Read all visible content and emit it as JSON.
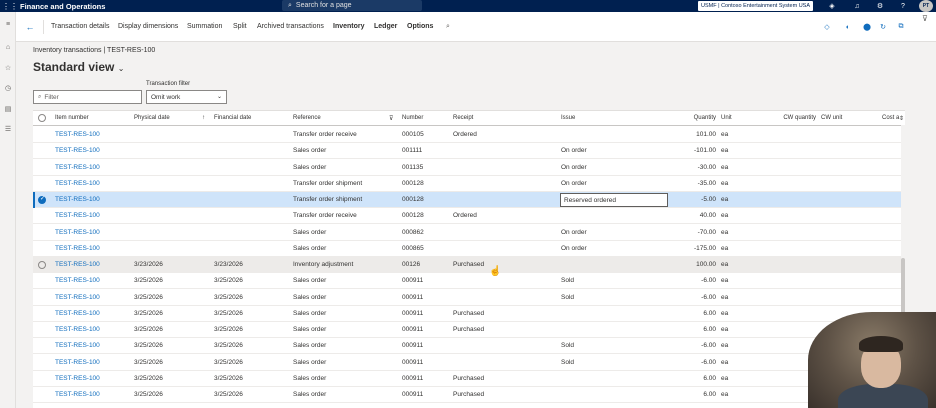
{
  "topbar": {
    "app_title": "Finance and Operations",
    "search_placeholder": "Search for a page",
    "company": "USMF | Contoso Entertainment System USA",
    "user_initials": "PT"
  },
  "actionpane": {
    "items": [
      {
        "label": "Transaction details",
        "bold": false
      },
      {
        "label": "Display dimensions",
        "bold": false
      },
      {
        "label": "Summation",
        "bold": false
      },
      {
        "label": "Split",
        "bold": false
      },
      {
        "label": "Archived transactions",
        "bold": false
      },
      {
        "label": "Inventory",
        "bold": true
      },
      {
        "label": "Ledger",
        "bold": true
      },
      {
        "label": "Options",
        "bold": true
      }
    ]
  },
  "breadcrumb": "Inventory transactions  |  TEST-RES-100",
  "page_title": "Standard view",
  "filter": {
    "placeholder": "Filter"
  },
  "transaction_filter": {
    "label": "Transaction filter",
    "value": "Omit work"
  },
  "grid": {
    "columns": {
      "item_number": "Item number",
      "physical_date": "Physical date",
      "financial_date": "Financial date",
      "reference": "Reference",
      "number": "Number",
      "receipt": "Receipt",
      "issue": "Issue",
      "quantity": "Quantity",
      "unit": "Unit",
      "cw_quantity": "CW quantity",
      "cw_unit": "CW unit",
      "cost": "Cost a"
    },
    "rows": [
      {
        "item": "TEST-RES-100",
        "phys": "",
        "fin": "",
        "ref": "Transfer order receive",
        "num": "000105",
        "receipt": "Ordered",
        "issue": "",
        "qty": "101.00",
        "unit": "ea"
      },
      {
        "item": "TEST-RES-100",
        "phys": "",
        "fin": "",
        "ref": "Sales order",
        "num": "001111",
        "receipt": "",
        "issue": "On order",
        "qty": "-101.00",
        "unit": "ea"
      },
      {
        "item": "TEST-RES-100",
        "phys": "",
        "fin": "",
        "ref": "Sales order",
        "num": "001135",
        "receipt": "",
        "issue": "On order",
        "qty": "-30.00",
        "unit": "ea"
      },
      {
        "item": "TEST-RES-100",
        "phys": "",
        "fin": "",
        "ref": "Transfer order shipment",
        "num": "000128",
        "receipt": "",
        "issue": "On order",
        "qty": "-35.00",
        "unit": "ea"
      },
      {
        "item": "TEST-RES-100",
        "phys": "",
        "fin": "",
        "ref": "Transfer order shipment",
        "num": "000128",
        "receipt": "",
        "issue": "Reserved ordered",
        "qty": "-5.00",
        "unit": "ea"
      },
      {
        "item": "TEST-RES-100",
        "phys": "",
        "fin": "",
        "ref": "Transfer order receive",
        "num": "000128",
        "receipt": "Ordered",
        "issue": "",
        "qty": "40.00",
        "unit": "ea"
      },
      {
        "item": "TEST-RES-100",
        "phys": "",
        "fin": "",
        "ref": "Sales order",
        "num": "000862",
        "receipt": "",
        "issue": "On order",
        "qty": "-70.00",
        "unit": "ea"
      },
      {
        "item": "TEST-RES-100",
        "phys": "",
        "fin": "",
        "ref": "Sales order",
        "num": "000865",
        "receipt": "",
        "issue": "On order",
        "qty": "-175.00",
        "unit": "ea"
      },
      {
        "item": "TEST-RES-100",
        "phys": "3/23/2026",
        "fin": "3/23/2026",
        "ref": "Inventory adjustment",
        "num": "00126",
        "receipt": "Purchased",
        "issue": "",
        "qty": "100.00",
        "unit": "ea"
      },
      {
        "item": "TEST-RES-100",
        "phys": "3/25/2026",
        "fin": "3/25/2026",
        "ref": "Sales order",
        "num": "000911",
        "receipt": "",
        "issue": "Sold",
        "qty": "-6.00",
        "unit": "ea"
      },
      {
        "item": "TEST-RES-100",
        "phys": "3/25/2026",
        "fin": "3/25/2026",
        "ref": "Sales order",
        "num": "000911",
        "receipt": "",
        "issue": "Sold",
        "qty": "-6.00",
        "unit": "ea"
      },
      {
        "item": "TEST-RES-100",
        "phys": "3/25/2026",
        "fin": "3/25/2026",
        "ref": "Sales order",
        "num": "000911",
        "receipt": "Purchased",
        "issue": "",
        "qty": "6.00",
        "unit": "ea"
      },
      {
        "item": "TEST-RES-100",
        "phys": "3/25/2026",
        "fin": "3/25/2026",
        "ref": "Sales order",
        "num": "000911",
        "receipt": "Purchased",
        "issue": "",
        "qty": "6.00",
        "unit": "ea"
      },
      {
        "item": "TEST-RES-100",
        "phys": "3/25/2026",
        "fin": "3/25/2026",
        "ref": "Sales order",
        "num": "000911",
        "receipt": "",
        "issue": "Sold",
        "qty": "-6.00",
        "unit": "ea"
      },
      {
        "item": "TEST-RES-100",
        "phys": "3/25/2026",
        "fin": "3/25/2026",
        "ref": "Sales order",
        "num": "000911",
        "receipt": "",
        "issue": "Sold",
        "qty": "-6.00",
        "unit": "ea"
      },
      {
        "item": "TEST-RES-100",
        "phys": "3/25/2026",
        "fin": "3/25/2026",
        "ref": "Sales order",
        "num": "000911",
        "receipt": "Purchased",
        "issue": "",
        "qty": "6.00",
        "unit": "ea"
      },
      {
        "item": "TEST-RES-100",
        "phys": "3/25/2026",
        "fin": "3/25/2026",
        "ref": "Sales order",
        "num": "000911",
        "receipt": "Purchased",
        "issue": "",
        "qty": "6.00",
        "unit": "ea"
      }
    ],
    "selected_row": 4,
    "hover_row": 8
  },
  "colors": {
    "accent": "#0f6cbd",
    "topbar": "#002050",
    "selected_row": "#cfe4fa"
  }
}
